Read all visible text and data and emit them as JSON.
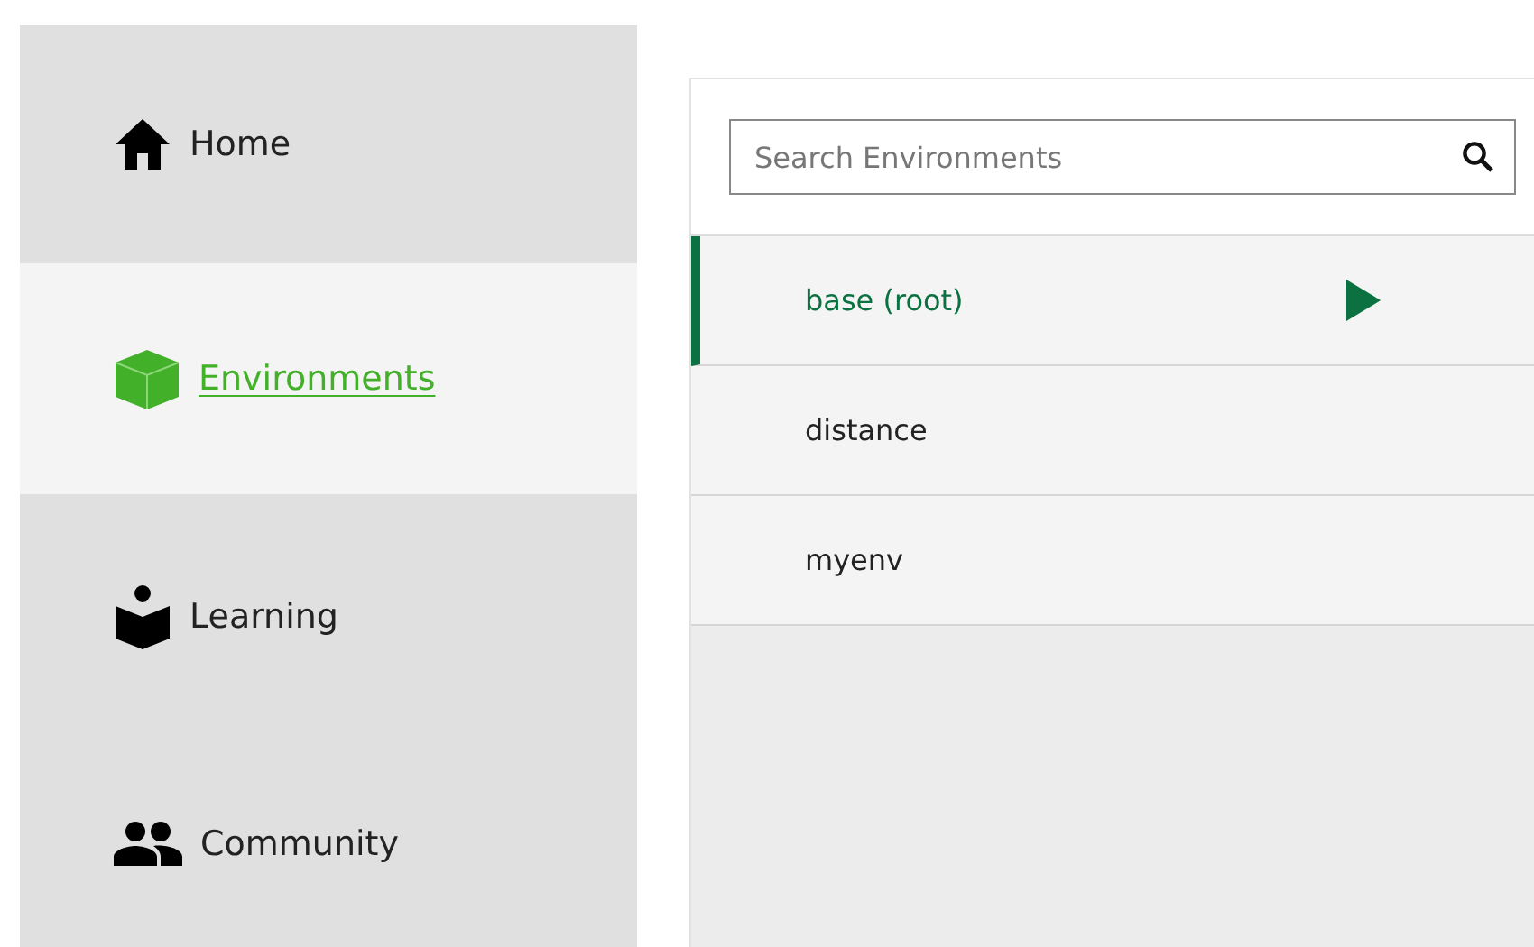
{
  "sidebar": {
    "items": [
      {
        "label": "Home",
        "selected": false
      },
      {
        "label": "Environments",
        "selected": true
      },
      {
        "label": "Learning",
        "selected": false
      },
      {
        "label": "Community",
        "selected": false
      }
    ]
  },
  "search": {
    "placeholder": "Search Environments"
  },
  "environments": [
    {
      "name": "base (root)",
      "selected": true
    },
    {
      "name": "distance",
      "selected": false
    },
    {
      "name": "myenv",
      "selected": false
    }
  ]
}
